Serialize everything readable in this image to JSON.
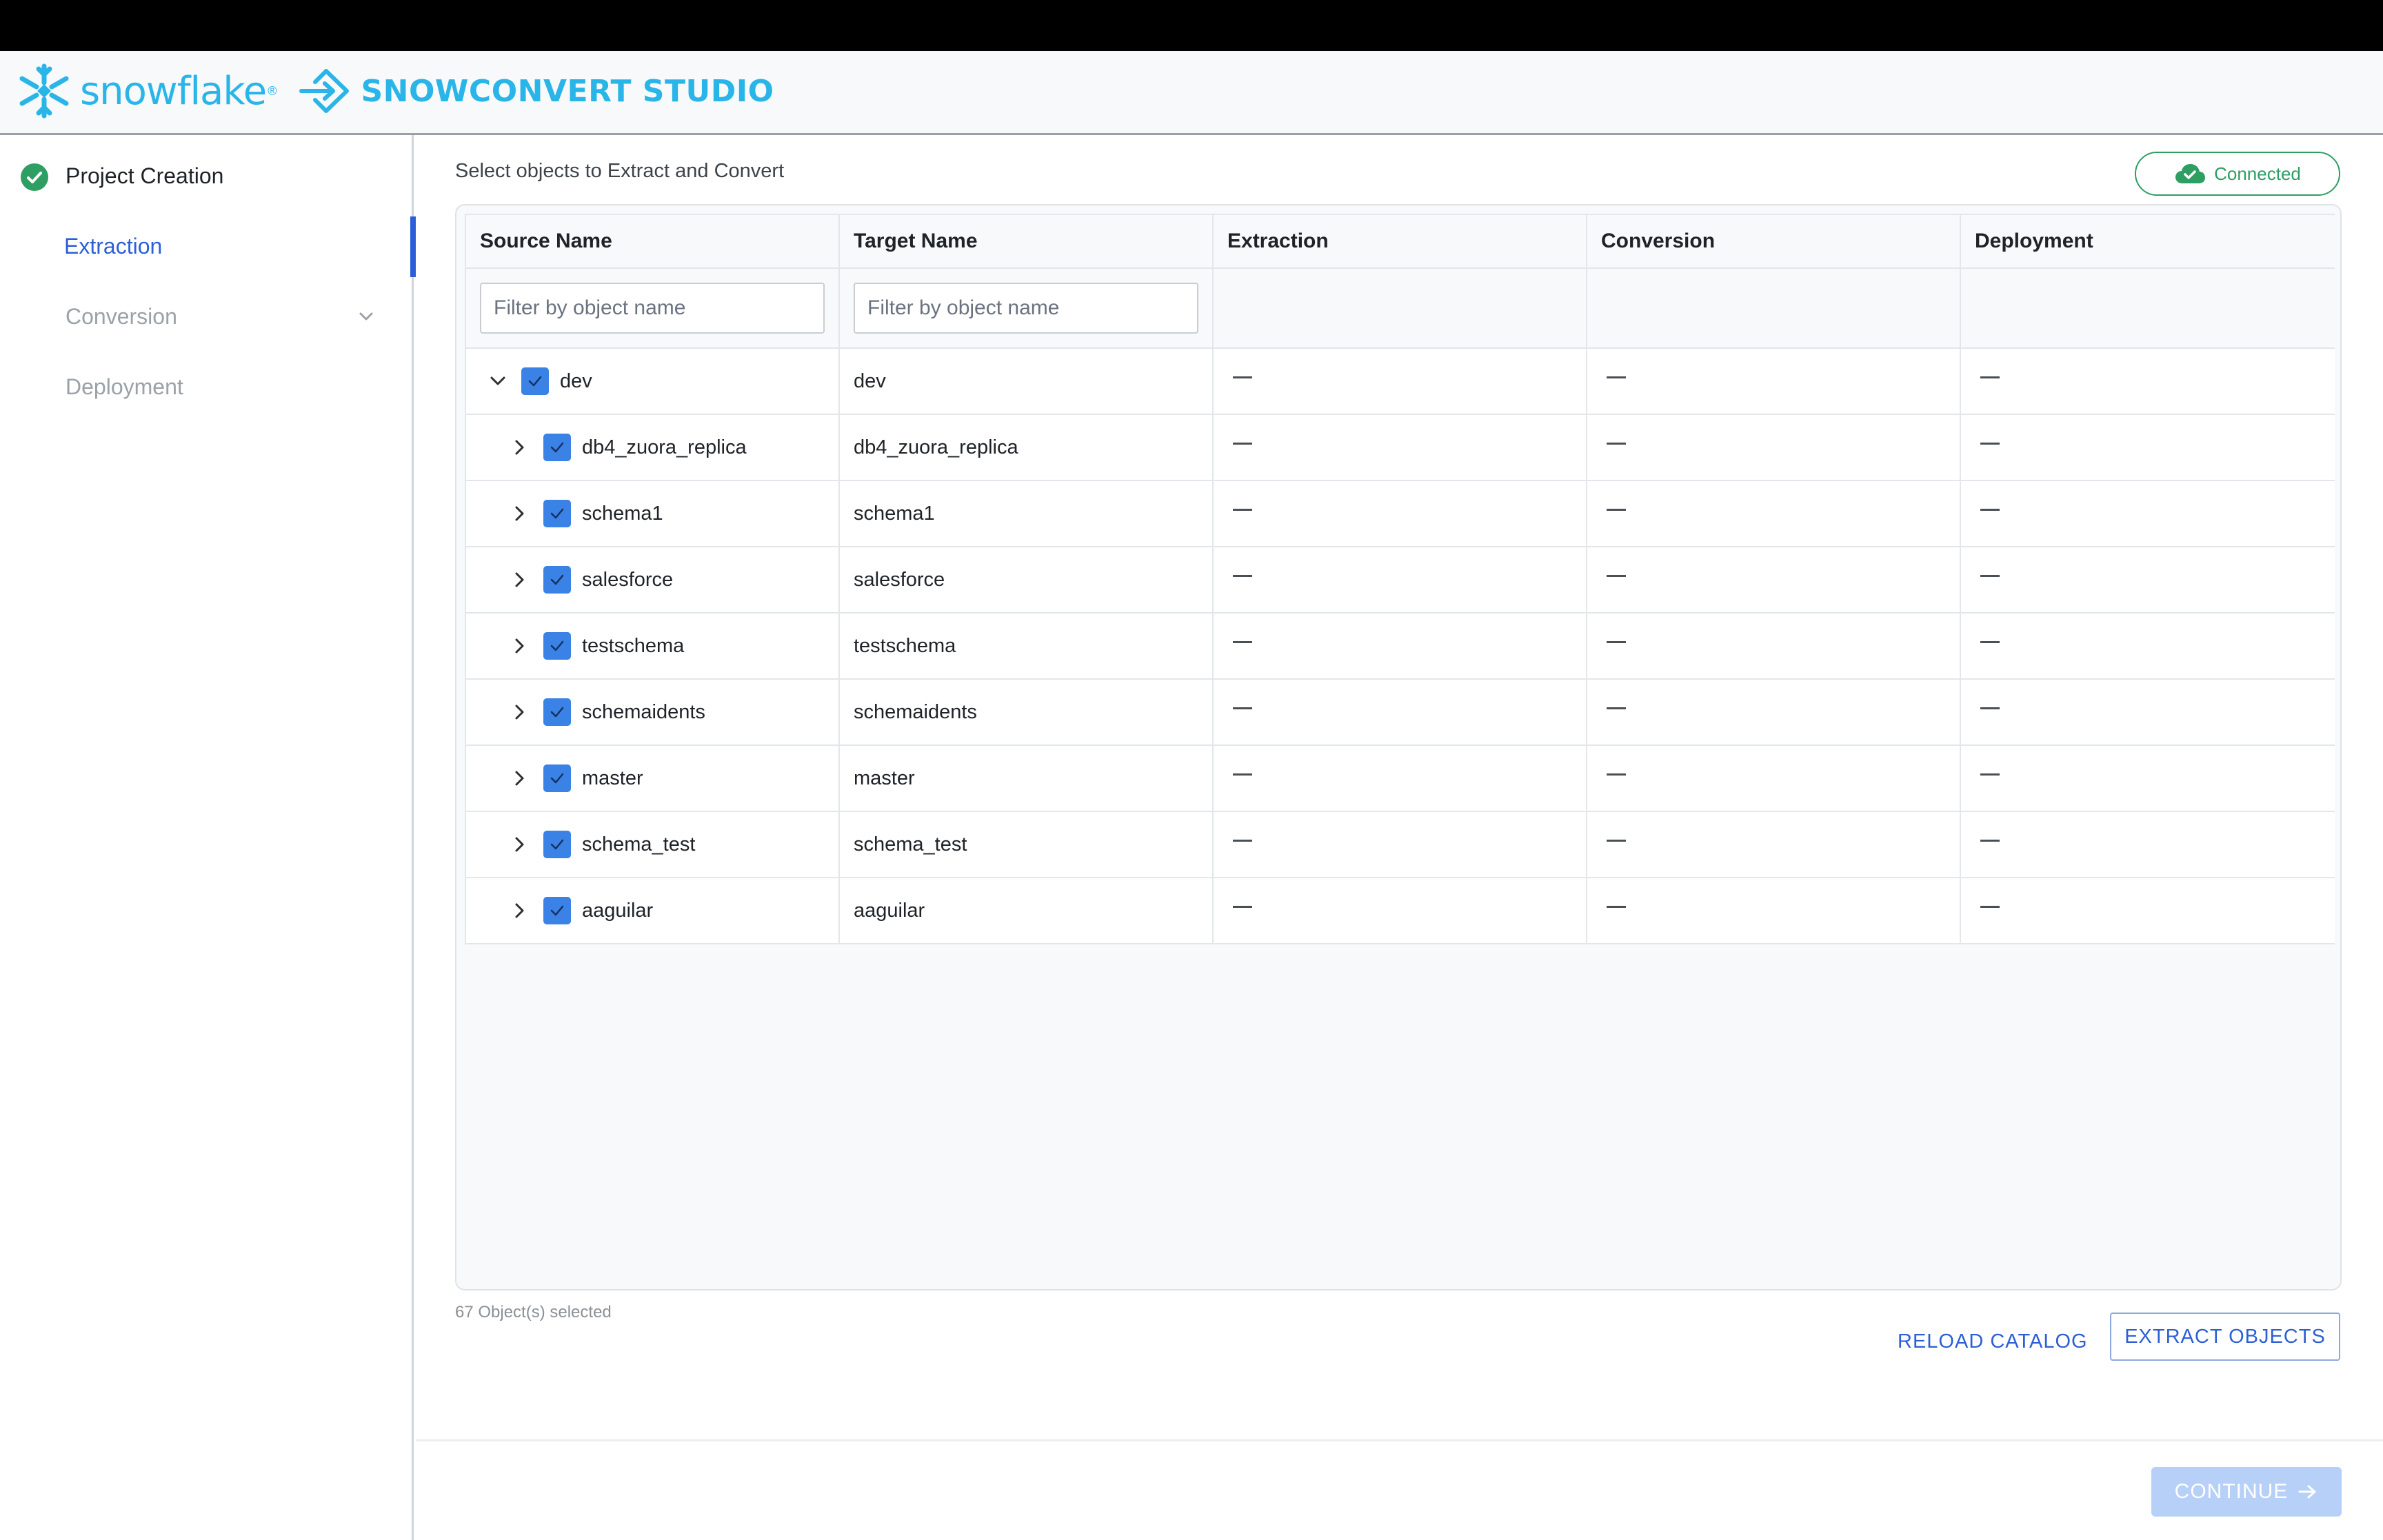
{
  "header": {
    "brand_name": "snowflake",
    "brand_mark": "®",
    "product_name": "SNOWCONVERT STUDIO"
  },
  "sidebar": {
    "items": [
      {
        "label": "Project Creation",
        "state": "completed",
        "icon": "check-circle-icon"
      },
      {
        "label": "Extraction",
        "state": "active"
      },
      {
        "label": "Conversion",
        "state": "disabled",
        "icon": "chevron-down-icon"
      },
      {
        "label": "Deployment",
        "state": "disabled"
      }
    ]
  },
  "main": {
    "title": "Select objects to Extract and Convert",
    "status": {
      "label": "Connected",
      "icon": "cloud-check-icon",
      "color": "#2e9e63"
    },
    "table": {
      "columns": [
        "Source Name",
        "Target Name",
        "Extraction",
        "Conversion",
        "Deployment"
      ],
      "filter_placeholder": "Filter by object name",
      "rows": [
        {
          "source": "dev",
          "target": "dev",
          "level": 0,
          "expanded": true,
          "checked": true
        },
        {
          "source": "db4_zuora_replica",
          "target": "db4_zuora_replica",
          "level": 1,
          "expanded": false,
          "checked": true
        },
        {
          "source": "schema1",
          "target": "schema1",
          "level": 1,
          "expanded": false,
          "checked": true
        },
        {
          "source": "salesforce",
          "target": "salesforce",
          "level": 1,
          "expanded": false,
          "checked": true
        },
        {
          "source": "testschema",
          "target": "testschema",
          "level": 1,
          "expanded": false,
          "checked": true
        },
        {
          "source": "schemaidents",
          "target": "schemaidents",
          "level": 1,
          "expanded": false,
          "checked": true
        },
        {
          "source": "master",
          "target": "master",
          "level": 1,
          "expanded": false,
          "checked": true
        },
        {
          "source": "schema_test",
          "target": "schema_test",
          "level": 1,
          "expanded": false,
          "checked": true
        },
        {
          "source": "aaguilar",
          "target": "aaguilar",
          "level": 1,
          "expanded": false,
          "checked": true
        }
      ]
    },
    "selected_count": "67 Object(s) selected",
    "reload_label": "RELOAD CATALOG",
    "extract_label": "EXTRACT OBJECTS"
  },
  "footer": {
    "continue_label": "CONTINUE",
    "continue_icon": "arrow-right-icon"
  },
  "colors": {
    "accent": "#2c5fd6",
    "brand": "#29b5e8",
    "checkbox": "#3b82e6",
    "success": "#2e9e63"
  }
}
